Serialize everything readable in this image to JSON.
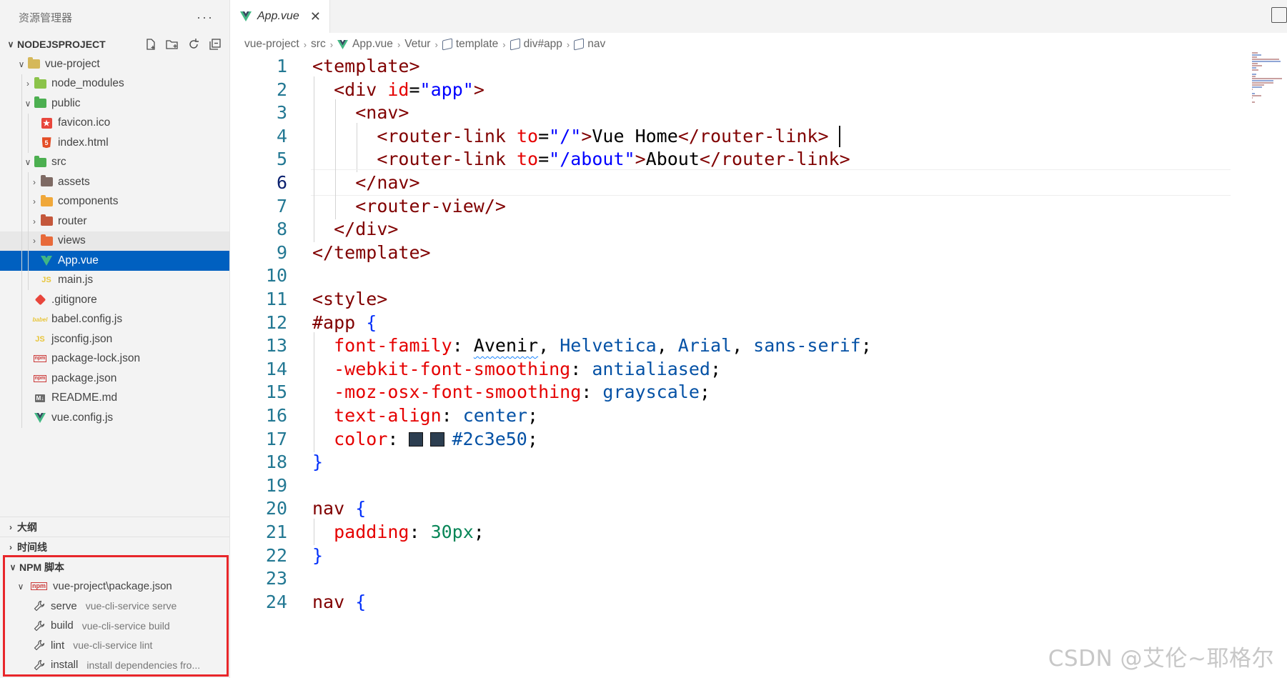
{
  "sidebar": {
    "header_title": "资源管理器",
    "more_label": "···",
    "explorer_section": "NODEJSPROJECT",
    "tree": [
      {
        "label": "vue-project",
        "depth": 1,
        "chevron": "down",
        "icon": "folder-icon",
        "color": "#d5b85a"
      },
      {
        "label": "node_modules",
        "depth": 2,
        "chevron": "right",
        "icon": "node-folder-icon",
        "color": "#8bc34a"
      },
      {
        "label": "public",
        "depth": 2,
        "chevron": "down",
        "icon": "public-folder-icon",
        "color": "#4caf50"
      },
      {
        "label": "favicon.ico",
        "depth": 3,
        "chevron": "none",
        "icon": "star-file-icon",
        "color": "#e8463c"
      },
      {
        "label": "index.html",
        "depth": 3,
        "chevron": "none",
        "icon": "html5-icon",
        "color": "#e44d26"
      },
      {
        "label": "src",
        "depth": 2,
        "chevron": "down",
        "icon": "src-folder-icon",
        "color": "#4caf50"
      },
      {
        "label": "assets",
        "depth": 3,
        "chevron": "right",
        "icon": "assets-folder-icon",
        "color": "#7e6a64"
      },
      {
        "label": "components",
        "depth": 3,
        "chevron": "right",
        "icon": "components-folder-icon",
        "color": "#f0a83a"
      },
      {
        "label": "router",
        "depth": 3,
        "chevron": "right",
        "icon": "router-folder-icon",
        "color": "#c4573b"
      },
      {
        "label": "views",
        "depth": 3,
        "chevron": "right",
        "icon": "views-folder-icon",
        "color": "#e86a3a",
        "state": "hover"
      },
      {
        "label": "App.vue",
        "depth": 3,
        "chevron": "none",
        "icon": "vue-icon",
        "color": "#42b883",
        "state": "selected"
      },
      {
        "label": "main.js",
        "depth": 3,
        "chevron": "none",
        "icon": "js-icon",
        "color": "#e8c53a"
      },
      {
        "label": ".gitignore",
        "depth": 2,
        "chevron": "none",
        "icon": "git-icon",
        "color": "#e8463c"
      },
      {
        "label": "babel.config.js",
        "depth": 2,
        "chevron": "none",
        "icon": "babel-icon",
        "color": "#e8c53a"
      },
      {
        "label": "jsconfig.json",
        "depth": 2,
        "chevron": "none",
        "icon": "js-icon",
        "color": "#e8c53a"
      },
      {
        "label": "package-lock.json",
        "depth": 2,
        "chevron": "none",
        "icon": "npm-icon",
        "color": "#cb3837"
      },
      {
        "label": "package.json",
        "depth": 2,
        "chevron": "none",
        "icon": "npm-icon",
        "color": "#cb3837"
      },
      {
        "label": "README.md",
        "depth": 2,
        "chevron": "none",
        "icon": "markdown-icon",
        "color": "#6b6b6b"
      },
      {
        "label": "vue.config.js",
        "depth": 2,
        "chevron": "none",
        "icon": "vue-icon",
        "color": "#42b883"
      }
    ],
    "outline_section": "大纲",
    "timeline_section": "时间线",
    "npm_section": "NPM 脚本",
    "npm_package": "vue-project\\package.json",
    "npm_scripts": [
      {
        "name": "serve",
        "command": "vue-cli-service serve"
      },
      {
        "name": "build",
        "command": "vue-cli-service build"
      },
      {
        "name": "lint",
        "command": "vue-cli-service lint"
      },
      {
        "name": "install",
        "command": "install dependencies fro..."
      }
    ],
    "highlight_color": "#e8262a"
  },
  "editor": {
    "tab_label": "App.vue",
    "tab_close": "✕",
    "breadcrumb": [
      "vue-project",
      "src",
      "App.vue",
      "Vetur",
      "template",
      "div#app",
      "nav"
    ],
    "active_line": 6,
    "lines": [
      {
        "n": "1",
        "tokens": [
          [
            "tag",
            "<template>"
          ]
        ]
      },
      {
        "n": "2",
        "tokens": [
          [
            "txt",
            "  "
          ],
          [
            "tag",
            "<div "
          ],
          [
            "attr",
            "id"
          ],
          [
            "punc",
            "="
          ],
          [
            "str",
            "\"app\""
          ],
          [
            "tag",
            ">"
          ]
        ]
      },
      {
        "n": "3",
        "tokens": [
          [
            "txt",
            "    "
          ],
          [
            "tag",
            "<nav>"
          ]
        ]
      },
      {
        "n": "4",
        "tokens": [
          [
            "txt",
            "      "
          ],
          [
            "tag",
            "<router-link "
          ],
          [
            "attr",
            "to"
          ],
          [
            "punc",
            "="
          ],
          [
            "str",
            "\"/\""
          ],
          [
            "tag",
            ">"
          ],
          [
            "txt",
            "Vue Home"
          ],
          [
            "tag",
            "</router-link>"
          ]
        ],
        "cursor": true
      },
      {
        "n": "5",
        "tokens": [
          [
            "txt",
            "      "
          ],
          [
            "tag",
            "<router-link "
          ],
          [
            "attr",
            "to"
          ],
          [
            "punc",
            "="
          ],
          [
            "str",
            "\"/about\""
          ],
          [
            "tag",
            ">"
          ],
          [
            "txt",
            "About"
          ],
          [
            "tag",
            "</router-link>"
          ]
        ]
      },
      {
        "n": "6",
        "tokens": [
          [
            "txt",
            "    "
          ],
          [
            "tag",
            "</nav>"
          ]
        ]
      },
      {
        "n": "7",
        "tokens": [
          [
            "txt",
            "    "
          ],
          [
            "tag",
            "<router-view/>"
          ]
        ]
      },
      {
        "n": "8",
        "tokens": [
          [
            "txt",
            "  "
          ],
          [
            "tag",
            "</div>"
          ]
        ]
      },
      {
        "n": "9",
        "tokens": [
          [
            "tag",
            "</template>"
          ]
        ]
      },
      {
        "n": "10",
        "tokens": []
      },
      {
        "n": "11",
        "tokens": [
          [
            "tag",
            "<style>"
          ]
        ]
      },
      {
        "n": "12",
        "tokens": [
          [
            "sel",
            "#app "
          ],
          [
            "brace",
            "{"
          ]
        ]
      },
      {
        "n": "13",
        "tokens": [
          [
            "txt",
            "  "
          ],
          [
            "prop",
            "font-family"
          ],
          [
            "punc",
            ": "
          ],
          [
            "squig",
            "Avenir"
          ],
          [
            "punc",
            ", "
          ],
          [
            "val",
            "Helvetica"
          ],
          [
            "punc",
            ", "
          ],
          [
            "val",
            "Arial"
          ],
          [
            "punc",
            ", "
          ],
          [
            "val",
            "sans-serif"
          ],
          [
            "punc",
            ";"
          ]
        ]
      },
      {
        "n": "14",
        "tokens": [
          [
            "txt",
            "  "
          ],
          [
            "prop",
            "-webkit-font-smoothing"
          ],
          [
            "punc",
            ": "
          ],
          [
            "val",
            "antialiased"
          ],
          [
            "punc",
            ";"
          ]
        ]
      },
      {
        "n": "15",
        "tokens": [
          [
            "txt",
            "  "
          ],
          [
            "prop",
            "-moz-osx-font-smoothing"
          ],
          [
            "punc",
            ": "
          ],
          [
            "val",
            "grayscale"
          ],
          [
            "punc",
            ";"
          ]
        ]
      },
      {
        "n": "16",
        "tokens": [
          [
            "txt",
            "  "
          ],
          [
            "prop",
            "text-align"
          ],
          [
            "punc",
            ": "
          ],
          [
            "val",
            "center"
          ],
          [
            "punc",
            ";"
          ]
        ]
      },
      {
        "n": "17",
        "tokens": [
          [
            "txt",
            "  "
          ],
          [
            "prop",
            "color"
          ],
          [
            "punc",
            ": "
          ],
          [
            "swatch",
            ""
          ],
          [
            "swatch",
            ""
          ],
          [
            "val",
            "#2c3e50"
          ],
          [
            "punc",
            ";"
          ]
        ]
      },
      {
        "n": "18",
        "tokens": [
          [
            "brace",
            "}"
          ]
        ]
      },
      {
        "n": "19",
        "tokens": []
      },
      {
        "n": "20",
        "tokens": [
          [
            "sel",
            "nav "
          ],
          [
            "brace",
            "{"
          ]
        ]
      },
      {
        "n": "21",
        "tokens": [
          [
            "txt",
            "  "
          ],
          [
            "prop",
            "padding"
          ],
          [
            "punc",
            ": "
          ],
          [
            "num",
            "30px"
          ],
          [
            "punc",
            ";"
          ]
        ]
      },
      {
        "n": "22",
        "tokens": [
          [
            "brace",
            "}"
          ]
        ]
      },
      {
        "n": "23",
        "tokens": []
      },
      {
        "n": "24",
        "tokens": [
          [
            "sel",
            "nav "
          ],
          [
            "brace",
            "{"
          ]
        ]
      }
    ]
  },
  "watermark": "CSDN @艾伦~耶格尔"
}
